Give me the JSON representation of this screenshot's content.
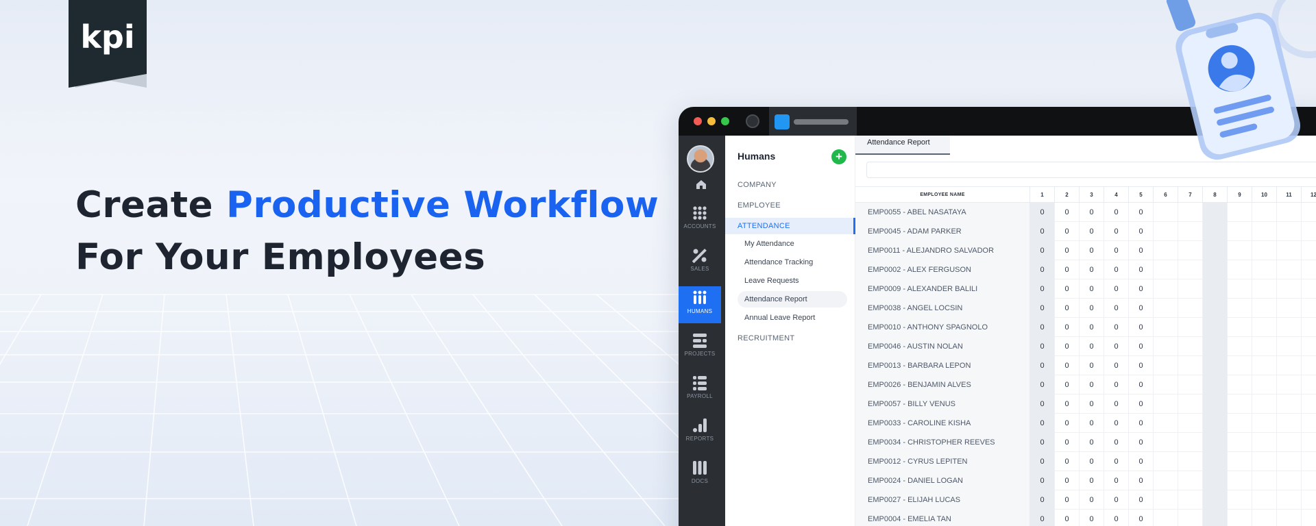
{
  "brand": {
    "logo_text": "kpi"
  },
  "headline": {
    "line1_prefix": "Create ",
    "line1_accent": "Productive Workflow",
    "line2": "For Your Employees"
  },
  "colors": {
    "accent": "#1a63f0",
    "rail_active": "#1e6ff2",
    "add_button": "#20b84a"
  },
  "rail": {
    "items": [
      {
        "label": "ACCOUNTS",
        "icon": "grid-icon"
      },
      {
        "label": "SALES",
        "icon": "percent-icon"
      },
      {
        "label": "HUMANS",
        "icon": "people-icon",
        "active": true
      },
      {
        "label": "PROJECTS",
        "icon": "projects-icon"
      },
      {
        "label": "PAYROLL",
        "icon": "list-icon"
      },
      {
        "label": "REPORTS",
        "icon": "bar-chart-icon"
      },
      {
        "label": "DOCS",
        "icon": "docs-icon"
      }
    ]
  },
  "subnav": {
    "title": "Humans",
    "sections": [
      "COMPANY",
      "EMPLOYEE",
      "ATTENDANCE",
      "RECRUITMENT"
    ],
    "attendance_items": [
      "My Attendance",
      "Attendance Tracking",
      "Leave Requests",
      "Attendance Report",
      "Annual Leave Report"
    ]
  },
  "main": {
    "tab": "Attendance Report",
    "column_name": "EMPLOYEE NAME",
    "days": [
      "1",
      "2",
      "3",
      "4",
      "5",
      "6",
      "7",
      "8",
      "9",
      "10",
      "11",
      "12"
    ],
    "rows": [
      {
        "name": "EMP0055 - ABEL NASATAYA",
        "values": [
          "0",
          "0",
          "0",
          "0",
          "0"
        ]
      },
      {
        "name": "EMP0045 - ADAM PARKER",
        "values": [
          "0",
          "0",
          "0",
          "0",
          "0"
        ]
      },
      {
        "name": "EMP0011 - ALEJANDRO SALVADOR",
        "values": [
          "0",
          "0",
          "0",
          "0",
          "0"
        ]
      },
      {
        "name": "EMP0002 - ALEX FERGUSON",
        "values": [
          "0",
          "0",
          "0",
          "0",
          "0"
        ]
      },
      {
        "name": "EMP0009 - ALEXANDER BALILI",
        "values": [
          "0",
          "0",
          "0",
          "0",
          "0"
        ]
      },
      {
        "name": "EMP0038 - ANGEL LOCSIN",
        "values": [
          "0",
          "0",
          "0",
          "0",
          "0"
        ]
      },
      {
        "name": "EMP0010 - ANTHONY SPAGNOLO",
        "values": [
          "0",
          "0",
          "0",
          "0",
          "0"
        ]
      },
      {
        "name": "EMP0046 - AUSTIN NOLAN",
        "values": [
          "0",
          "0",
          "0",
          "0",
          "0"
        ]
      },
      {
        "name": "EMP0013 - BARBARA LEPON",
        "values": [
          "0",
          "0",
          "0",
          "0",
          "0"
        ]
      },
      {
        "name": "EMP0026 - BENJAMIN ALVES",
        "values": [
          "0",
          "0",
          "0",
          "0",
          "0"
        ]
      },
      {
        "name": "EMP0057 - BILLY VENUS",
        "values": [
          "0",
          "0",
          "0",
          "0",
          "0"
        ]
      },
      {
        "name": "EMP0033 - CAROLINE KISHA",
        "values": [
          "0",
          "0",
          "0",
          "0",
          "0"
        ]
      },
      {
        "name": "EMP0034 - CHRISTOPHER REEVES",
        "values": [
          "0",
          "0",
          "0",
          "0",
          "0"
        ]
      },
      {
        "name": "EMP0012 - CYRUS LEPITEN",
        "values": [
          "0",
          "0",
          "0",
          "0",
          "0"
        ]
      },
      {
        "name": "EMP0024 - DANIEL LOGAN",
        "values": [
          "0",
          "0",
          "0",
          "0",
          "0"
        ]
      },
      {
        "name": "EMP0027 - ELIJAH LUCAS",
        "values": [
          "0",
          "0",
          "0",
          "0",
          "0"
        ]
      },
      {
        "name": "EMP0004 - EMELIA TAN",
        "values": [
          "0",
          "0",
          "0",
          "0",
          "0"
        ]
      }
    ]
  }
}
